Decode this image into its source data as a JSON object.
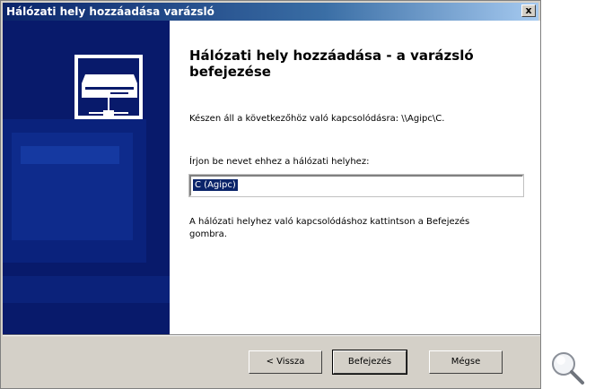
{
  "window": {
    "title": "Hálózati hely hozzáadása varázsló",
    "close_label": "x"
  },
  "content": {
    "heading": "Hálózati hely hozzáadása - a varázsló befejezése",
    "ready_text": "Készen áll a következőhöz való kapcsolódásra: \\\\Agipc\\C.",
    "name_label": "Írjon be nevet ehhez a hálózati helyhez:",
    "name_value": "C (Agipc)",
    "instruction": "A hálózati helyhez való kapcsolódáshoz kattintson a Befejezés gombra."
  },
  "buttons": {
    "back": "< Vissza",
    "finish": "Befejezés",
    "cancel": "Mégse"
  },
  "icons": {
    "side_graphic": "network-drive-icon",
    "zoom": "magnifier-icon"
  },
  "colors": {
    "title_bar": "#0a246a",
    "side_panel": "#081a6b",
    "selection": "#0a246a"
  }
}
